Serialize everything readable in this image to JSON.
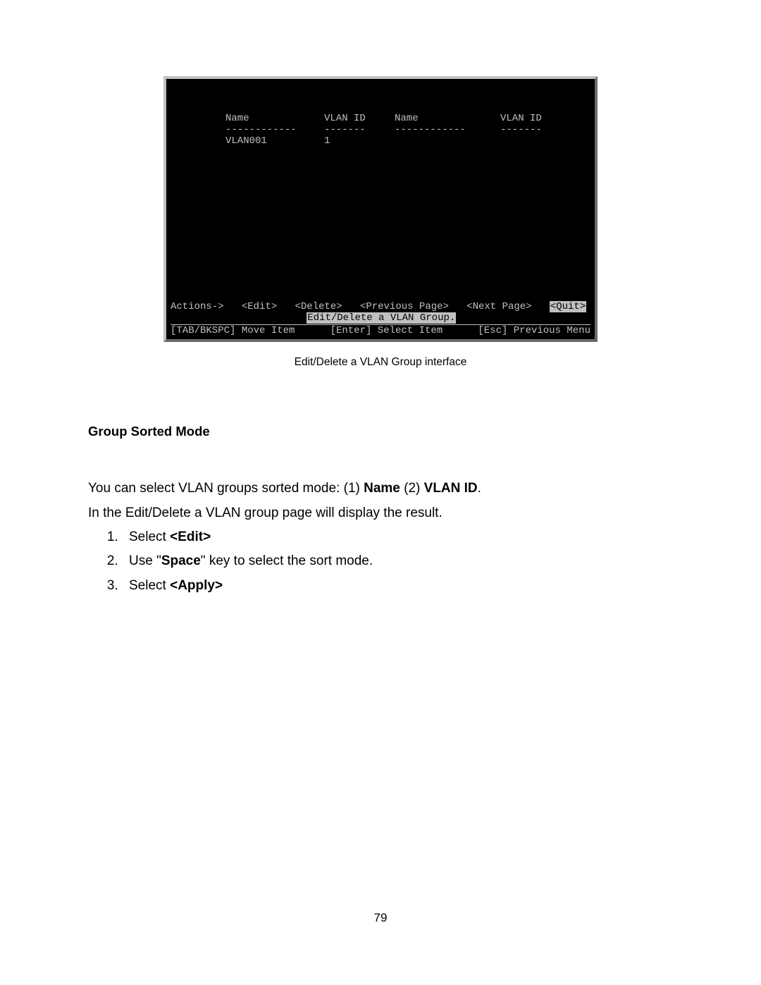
{
  "terminal": {
    "columns": {
      "name1": "Name",
      "vlan1": "VLAN ID",
      "name2": "Name",
      "vlan2": "VLAN ID"
    },
    "rows": [
      {
        "name": "VLAN001",
        "vlan_id": "1"
      }
    ],
    "actions_label": "Actions->",
    "actions": {
      "edit": "<Edit>",
      "delete": "<Delete>",
      "prev": "<Previous Page>",
      "next": "<Next Page>",
      "quit": "<Quit>"
    },
    "subtitle": "Edit/Delete a VLAN Group.",
    "help": {
      "move": "[TAB/BKSPC] Move Item",
      "select": "[Enter] Select Item",
      "back": "[Esc] Previous Menu"
    }
  },
  "caption": "Edit/Delete a VLAN Group interface",
  "section_heading": "Group Sorted Mode",
  "paragraph": {
    "line1_pre": "You can select VLAN groups sorted mode: (1) ",
    "line1_b1": "Name",
    "line1_mid": " (2) ",
    "line1_b2": "VLAN ID",
    "line1_post": ".",
    "line2": "In the Edit/Delete a VLAN group page will display the result."
  },
  "steps": [
    {
      "pre": "Select ",
      "b": "<Edit>",
      "post": ""
    },
    {
      "pre": "Use \"",
      "b": "Space",
      "post": "\" key to select the sort mode."
    },
    {
      "pre": "Select ",
      "b": "<Apply>",
      "post": ""
    }
  ],
  "page_number": "79"
}
